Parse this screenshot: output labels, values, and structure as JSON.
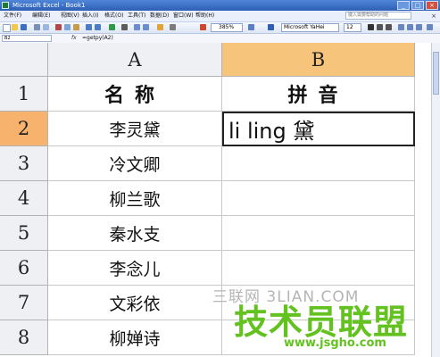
{
  "window": {
    "title": "Microsoft Excel - Book1"
  },
  "menu": {
    "items": [
      "文件(F)",
      "编辑(E)",
      "视图(V)",
      "插入(I)",
      "格式(O)",
      "工具(T)",
      "数据(D)",
      "窗口(W)",
      "帮助(H)"
    ],
    "help_placeholder": "键入需要帮助的问题"
  },
  "toolbar": {
    "zoom": "385%",
    "font": "Microsoft YaHei",
    "size": "12"
  },
  "formula_bar": {
    "name_box": "B2",
    "fx": "fx",
    "formula": "=getpy(A2)"
  },
  "sheet": {
    "columns": [
      "A",
      "B"
    ],
    "rows": [
      "1",
      "2",
      "3",
      "4",
      "5",
      "6",
      "7",
      "8"
    ],
    "header": {
      "a": "名称",
      "b": "拼音"
    },
    "cells": [
      "李灵黛",
      "冷文卿",
      "柳兰歌",
      "秦水支",
      "李念儿",
      "文彩依",
      "柳婵诗"
    ],
    "b2_value": "li ling 黛",
    "active_cell": "B2"
  },
  "watermark": {
    "line1": "三联网 3LIAN.COM",
    "line2": "技术员联盟",
    "line3": "www.jsgho.com"
  }
}
